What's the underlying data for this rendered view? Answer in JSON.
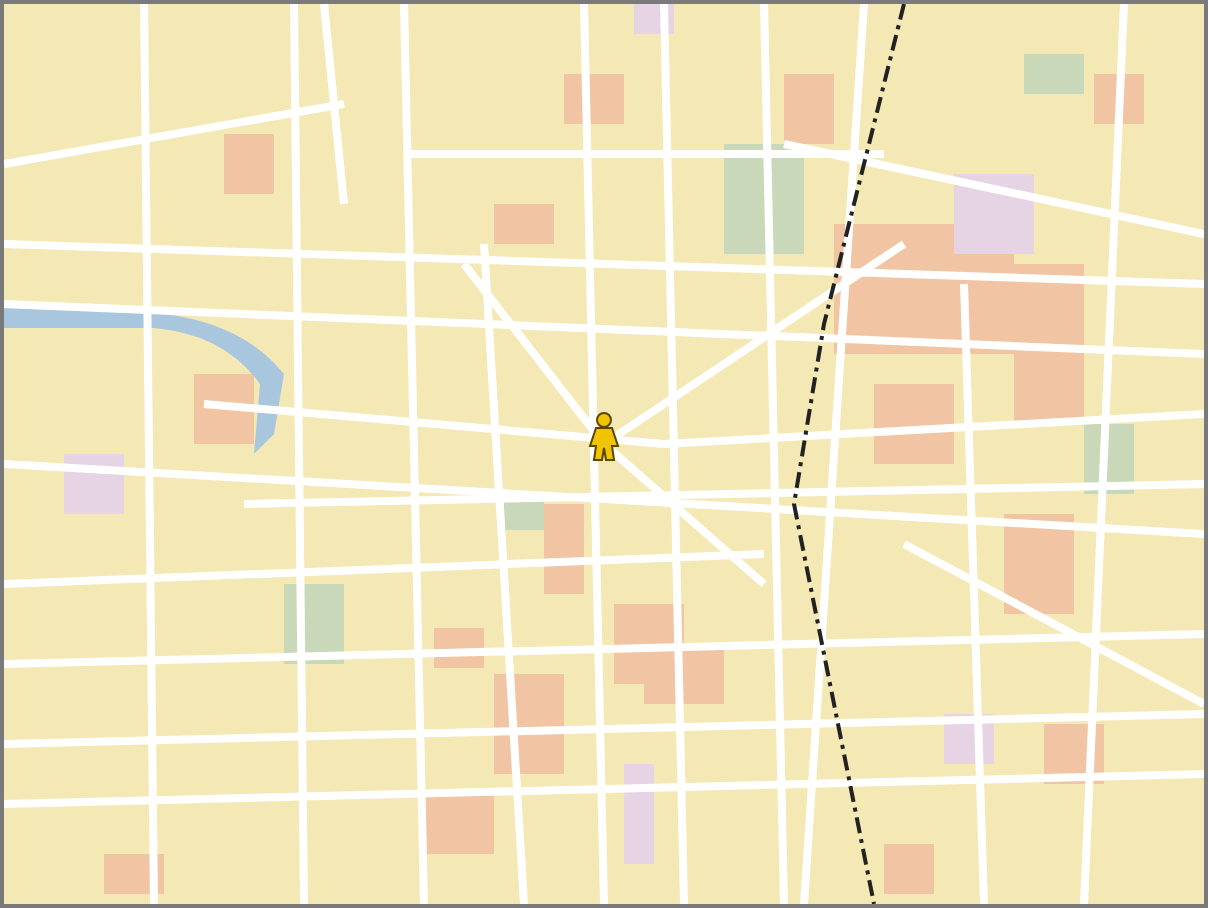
{
  "map": {
    "markers": [
      {
        "kind": "person"
      }
    ]
  }
}
